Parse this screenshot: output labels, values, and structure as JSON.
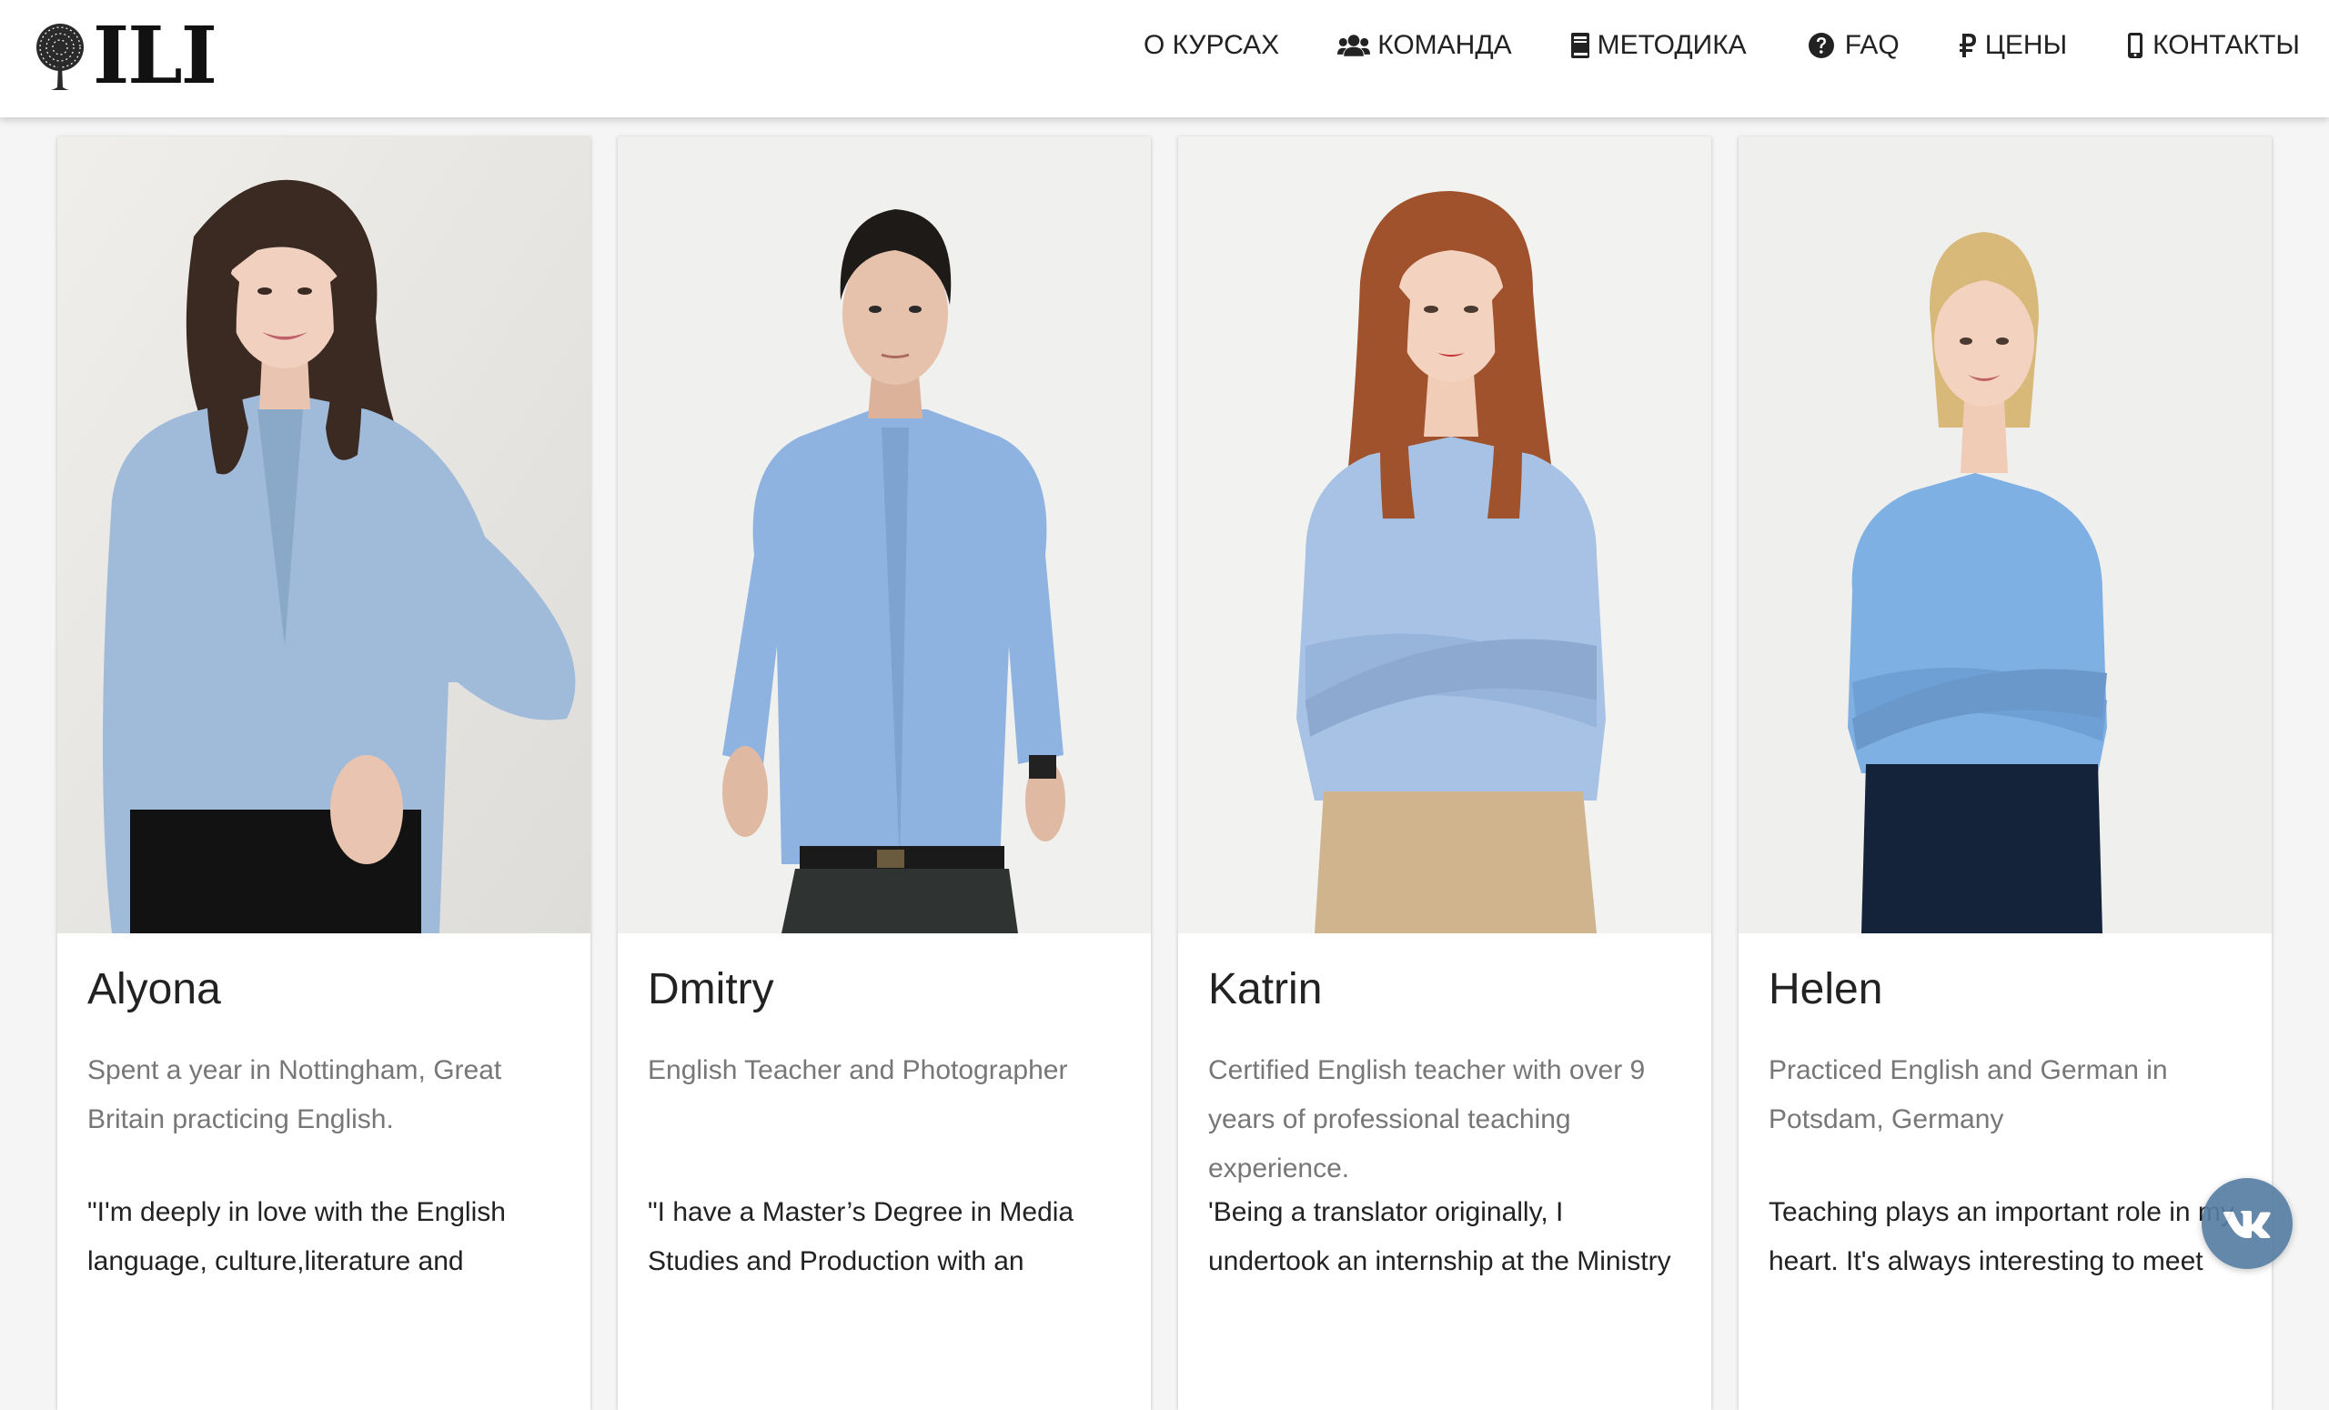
{
  "header": {
    "logo_text": "ILI",
    "nav": [
      {
        "label": "О КУРСАХ",
        "icon": "none"
      },
      {
        "label": "КОМАНДА",
        "icon": "users-icon"
      },
      {
        "label": "МЕТОДИКА",
        "icon": "book-icon"
      },
      {
        "label": "FAQ",
        "icon": "question-circle-icon"
      },
      {
        "label": "ЦЕНЫ",
        "icon": "ruble-icon"
      },
      {
        "label": "КОНТАКТЫ",
        "icon": "mobile-phone-icon"
      }
    ]
  },
  "team": [
    {
      "name": "Alyona",
      "role": "Spent a year in Nottingham, Great Britain practicing English.",
      "quote": "\"I'm deeply in love with the English language, culture,literature and",
      "colors": {
        "bg": "#ebe9e5",
        "shirt": "#9fbbd9",
        "hair": "#3b2a22",
        "pants": "#121212"
      }
    },
    {
      "name": "Dmitry",
      "role": "English Teacher and Photographer",
      "quote": "\"I have a Master’s Degree in Media Studies and Production with an",
      "colors": {
        "bg": "#f0f0ee",
        "shirt": "#8fb3e0",
        "hair": "#1e1a18",
        "pants": "#2f3433"
      }
    },
    {
      "name": "Katrin",
      "role": "Certified English teacher with over 9 years of professional teaching experience.",
      "quote": "'Being a translator originally, I undertook an internship at the Ministry",
      "colors": {
        "bg": "#f2f2f0",
        "shirt": "#a7c2e4",
        "hair": "#a0522d",
        "pants": "#cfb48e"
      }
    },
    {
      "name": "Helen",
      "role": "Practiced English and German in Potsdam, Germany",
      "quote": "Teaching plays an important role in my heart. It's always interesting to meet",
      "colors": {
        "bg": "#efefed",
        "shirt": "#7fb0e3",
        "hair": "#d9b97a",
        "pants": "#15233a"
      }
    }
  ],
  "social": {
    "icon": "vk-icon"
  }
}
